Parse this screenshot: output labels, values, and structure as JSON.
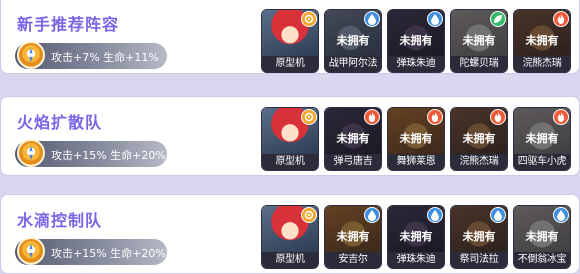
{
  "colors": {
    "title": "#7a64e8",
    "water": "#3f8fe0",
    "fire": "#ef5a3a",
    "leaf": "#37b96b",
    "light": "#f3a72c"
  },
  "labels": {
    "locked": "未拥有"
  },
  "cards": [
    {
      "title": "新手推荐阵容",
      "bonus": "攻击+7% 生命+11%",
      "heroes": [
        {
          "name": "原型机",
          "locked": false,
          "element": "light",
          "icon": "crosshair-icon",
          "art": "red-hair"
        },
        {
          "name": "战甲阿尔法",
          "locked": true,
          "element": "water",
          "icon": "water-drop-icon",
          "art": "mech"
        },
        {
          "name": "弹珠朱迪",
          "locked": true,
          "element": "water",
          "icon": "water-drop-icon",
          "art": "dark"
        },
        {
          "name": "陀螺贝瑞",
          "locked": true,
          "element": "leaf",
          "icon": "leaf-icon",
          "art": "pale"
        },
        {
          "name": "浣熊杰瑞",
          "locked": true,
          "element": "fire",
          "icon": "flame-icon",
          "art": "brown"
        }
      ]
    },
    {
      "title": "火焰扩散队",
      "bonus": "攻击+15% 生命+20%",
      "heroes": [
        {
          "name": "原型机",
          "locked": false,
          "element": "light",
          "icon": "crosshair-icon",
          "art": "red-hair"
        },
        {
          "name": "弹弓唐吉",
          "locked": true,
          "element": "fire",
          "icon": "flame-icon",
          "art": "dark"
        },
        {
          "name": "舞狮莱恩",
          "locked": true,
          "element": "fire",
          "icon": "flame-icon",
          "art": "orange"
        },
        {
          "name": "浣熊杰瑞",
          "locked": true,
          "element": "fire",
          "icon": "flame-icon",
          "art": "brown"
        },
        {
          "name": "四驱车小虎",
          "locked": true,
          "element": "fire",
          "icon": "flame-icon",
          "art": "pale"
        }
      ]
    },
    {
      "title": "水滴控制队",
      "bonus": "攻击+15% 生命+20%",
      "heroes": [
        {
          "name": "原型机",
          "locked": false,
          "element": "light",
          "icon": "crosshair-icon",
          "art": "red-hair"
        },
        {
          "name": "安吉尔",
          "locked": true,
          "element": "water",
          "icon": "water-drop-icon",
          "art": "orange"
        },
        {
          "name": "弹珠朱迪",
          "locked": true,
          "element": "water",
          "icon": "water-drop-icon",
          "art": "dark"
        },
        {
          "name": "祭司法拉",
          "locked": true,
          "element": "water",
          "icon": "water-drop-icon",
          "art": "brown"
        },
        {
          "name": "不倒翁冰宝",
          "locked": true,
          "element": "water",
          "icon": "water-drop-icon",
          "art": "pale"
        }
      ]
    }
  ]
}
